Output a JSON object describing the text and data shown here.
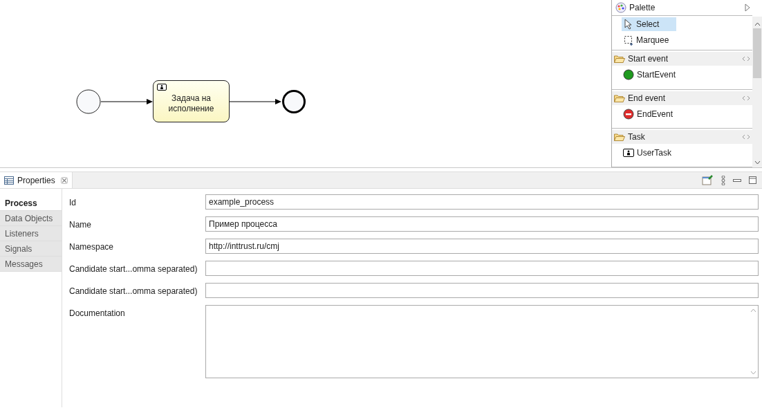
{
  "diagram": {
    "nodes": [
      {
        "kind": "start"
      },
      {
        "kind": "task",
        "label": "Задача на исполнение"
      },
      {
        "kind": "end"
      }
    ]
  },
  "palette": {
    "title": "Palette",
    "tools": [
      {
        "kind": "select",
        "label": "Select",
        "selected": true
      },
      {
        "kind": "marquee",
        "label": "Marquee",
        "selected": false
      }
    ],
    "drawers": [
      {
        "title": "Start event",
        "items": [
          {
            "kind": "start",
            "label": "StartEvent"
          }
        ]
      },
      {
        "title": "End event",
        "items": [
          {
            "kind": "end",
            "label": "EndEvent"
          }
        ]
      },
      {
        "title": "Task",
        "items": [
          {
            "kind": "usertask",
            "label": "UserTask"
          }
        ]
      }
    ]
  },
  "properties": {
    "title": "Properties",
    "sections": [
      {
        "label": "Process",
        "selected": true
      },
      {
        "label": "Data Objects",
        "selected": false
      },
      {
        "label": "Listeners",
        "selected": false
      },
      {
        "label": "Signals",
        "selected": false
      },
      {
        "label": "Messages",
        "selected": false
      }
    ],
    "fields": [
      {
        "kind": "text",
        "label": "Id",
        "value": "example_process"
      },
      {
        "kind": "text",
        "label": "Name",
        "value": "Пример процесса"
      },
      {
        "kind": "text",
        "label": "Namespace",
        "value": "http://inttrust.ru/cmj"
      },
      {
        "kind": "text",
        "label": "Candidate start...omma separated)"
      },
      {
        "kind": "text",
        "label": "Candidate start...omma separated)"
      },
      {
        "kind": "textarea",
        "label": "Documentation"
      }
    ]
  }
}
